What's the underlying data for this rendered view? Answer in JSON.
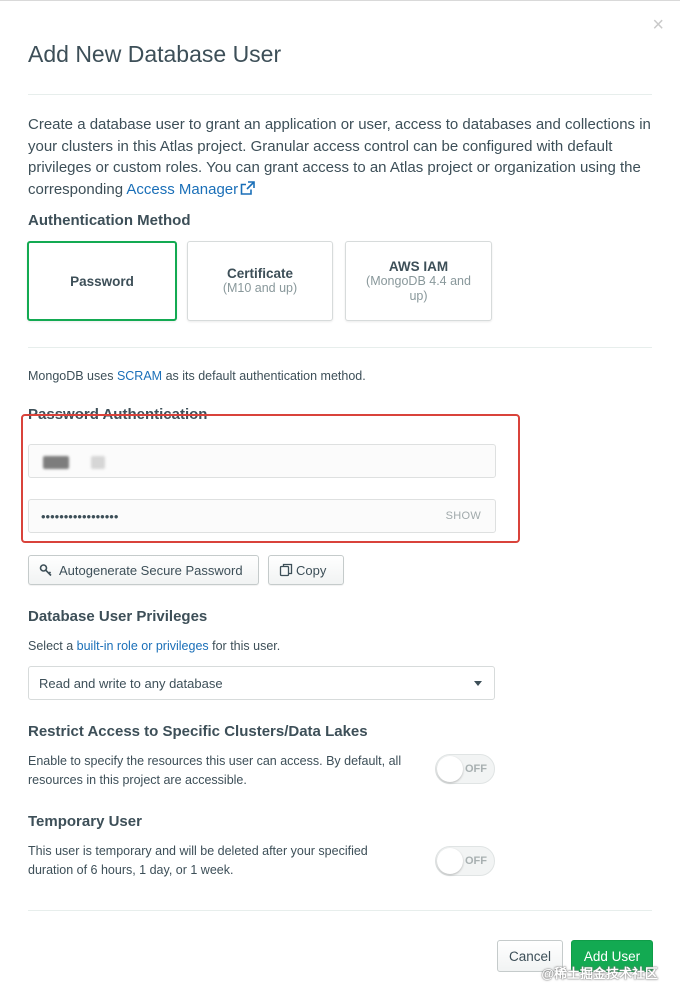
{
  "modal": {
    "title": "Add New Database User",
    "close_label": "×"
  },
  "intro": {
    "text": "Create a database user to grant an application or user, access to databases and collections in your clusters in this Atlas project. Granular access control can be configured with default privileges or custom roles. You can grant access to an Atlas project or organization using the corresponding ",
    "link_text": "Access Manager"
  },
  "auth_method": {
    "label": "Authentication Method",
    "options": [
      {
        "name": "Password",
        "sub": "",
        "selected": true
      },
      {
        "name": "Certificate",
        "sub": "(M10 and up)",
        "selected": false
      },
      {
        "name": "AWS IAM",
        "sub": "(MongoDB 4.4 and up)",
        "selected": false
      }
    ],
    "note_prefix": "MongoDB uses ",
    "note_link": "SCRAM",
    "note_suffix": " as its default authentication method."
  },
  "password_auth": {
    "label": "Password Authentication",
    "username_value": "",
    "password_value": "•••••••••••••••••",
    "show_label": "SHOW",
    "autogenerate_label": "Autogenerate Secure Password",
    "copy_label": "Copy"
  },
  "privileges": {
    "label": "Database User Privileges",
    "hint_prefix": "Select a ",
    "hint_link": "built-in role or privileges",
    "hint_suffix": " for this user.",
    "selected": "Read and write to any database"
  },
  "restrict": {
    "label": "Restrict Access to Specific Clusters/Data Lakes",
    "description": "Enable to specify the resources this user can access. By default, all resources in this project are accessible.",
    "toggle_label": "OFF"
  },
  "temporary": {
    "label": "Temporary User",
    "description": "This user is temporary and will be deleted after your specified duration of 6 hours, 1 day, or 1 week.",
    "toggle_label": "OFF"
  },
  "footer": {
    "cancel_label": "Cancel",
    "add_label": "Add User"
  },
  "watermark": "@稀土掘金技术社区",
  "colors": {
    "accent_green": "#13aa52",
    "link_blue": "#1a6fb8",
    "highlight_red": "#d9433b"
  }
}
